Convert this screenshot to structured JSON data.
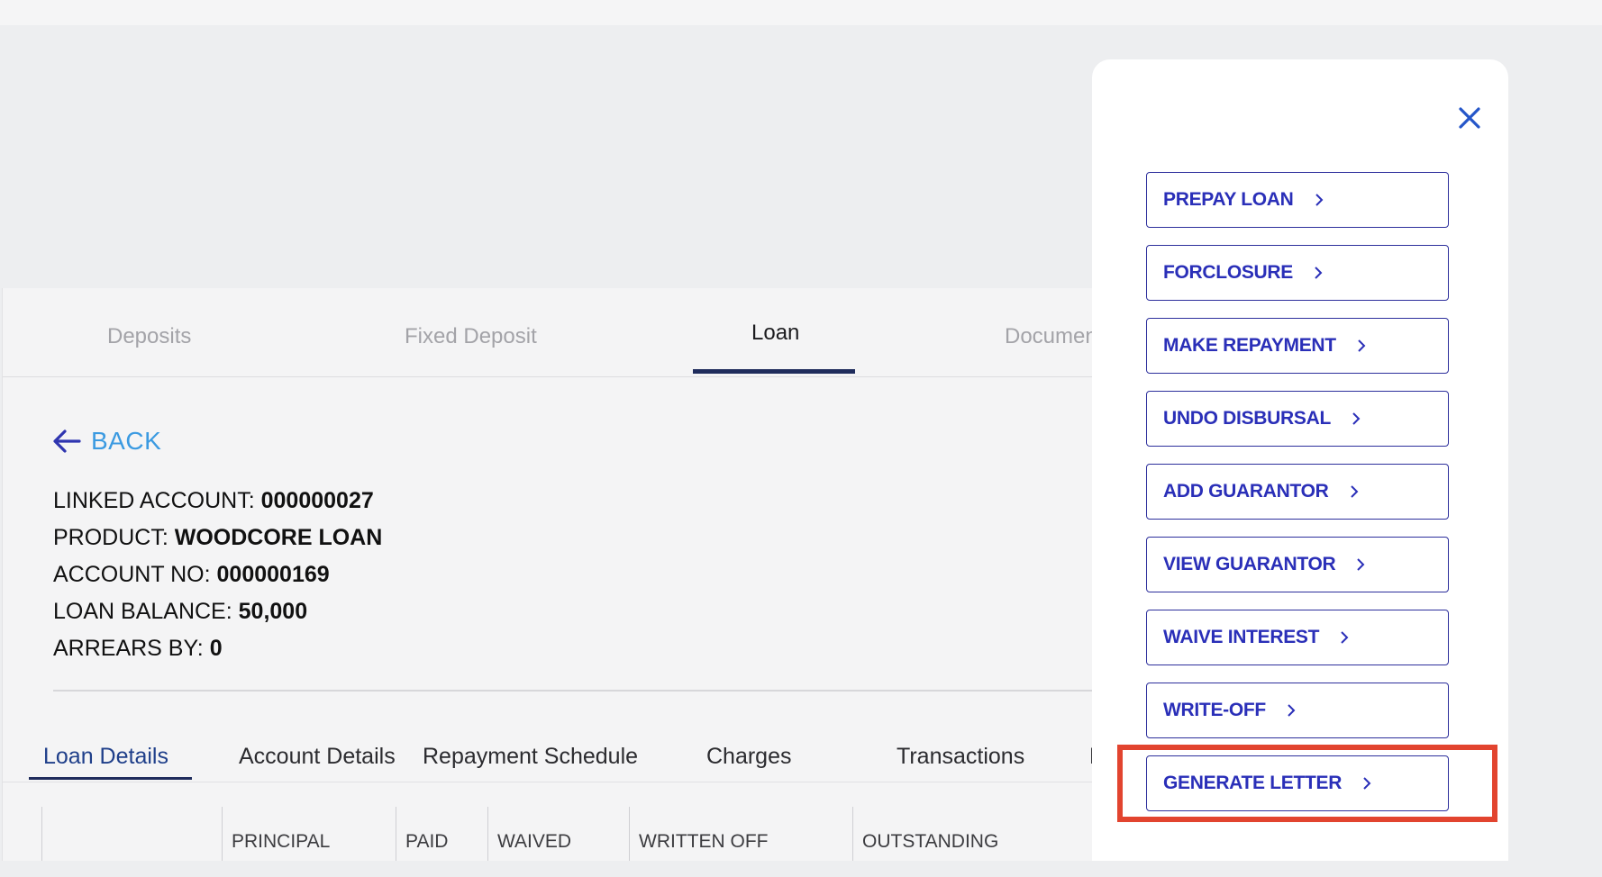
{
  "top_tabs": [
    {
      "label": "Deposits"
    },
    {
      "label": "Fixed Deposit"
    },
    {
      "label": "Loan"
    },
    {
      "label": "Documen"
    }
  ],
  "back_label": "BACK",
  "info": [
    {
      "key": "LINKED ACCOUNT:",
      "value": "000000027"
    },
    {
      "key": "PRODUCT:",
      "value": "WOODCORE LOAN"
    },
    {
      "key": "ACCOUNT NO:",
      "value": "000000169"
    },
    {
      "key": "LOAN BALANCE:",
      "value": "50,000"
    },
    {
      "key": "ARREARS BY:",
      "value": "0"
    }
  ],
  "sub_tabs": [
    {
      "label": "Loan Details"
    },
    {
      "label": "Account Details"
    },
    {
      "label": "Repayment Schedule"
    },
    {
      "label": "Charges"
    },
    {
      "label": "Transactions"
    },
    {
      "label": "L"
    }
  ],
  "table_headers": [
    "",
    "PRINCIPAL",
    "PAID",
    "WAIVED",
    "WRITTEN OFF",
    "OUTSTANDING"
  ],
  "actions": [
    {
      "label": "PREPAY LOAN"
    },
    {
      "label": "FORCLOSURE"
    },
    {
      "label": "MAKE REPAYMENT"
    },
    {
      "label": "UNDO DISBURSAL"
    },
    {
      "label": "ADD GUARANTOR"
    },
    {
      "label": "VIEW GUARANTOR"
    },
    {
      "label": "WAIVE INTEREST"
    },
    {
      "label": "WRITE-OFF"
    },
    {
      "label": "GENERATE LETTER"
    }
  ],
  "colors": {
    "accent": "#2a2fb8",
    "highlight": "#e2442f",
    "back": "#3b9ae1"
  },
  "icons": {
    "close": "close-icon",
    "back": "arrow-left-icon",
    "chevron": "chevron-right-icon"
  }
}
